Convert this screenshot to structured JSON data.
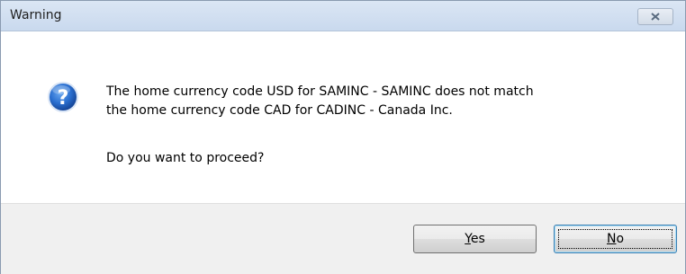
{
  "window": {
    "title": "Warning"
  },
  "titlebar": {
    "close_icon": "close-x-icon"
  },
  "message": {
    "icon": "question-icon",
    "line1": "The home currency code USD for SAMINC - SAMINC does not match",
    "line2": "the home currency code CAD for CADINC - Canada Inc.",
    "prompt": "Do you want to proceed?"
  },
  "buttons": {
    "yes": {
      "mnemonic": "Y",
      "rest": "es"
    },
    "no": {
      "mnemonic": "N",
      "rest": "o",
      "focused": true
    }
  },
  "colors": {
    "titlebar": "#c9d9ee",
    "footer": "#f0f0f0",
    "icon_blue": "#1f5fbf"
  }
}
